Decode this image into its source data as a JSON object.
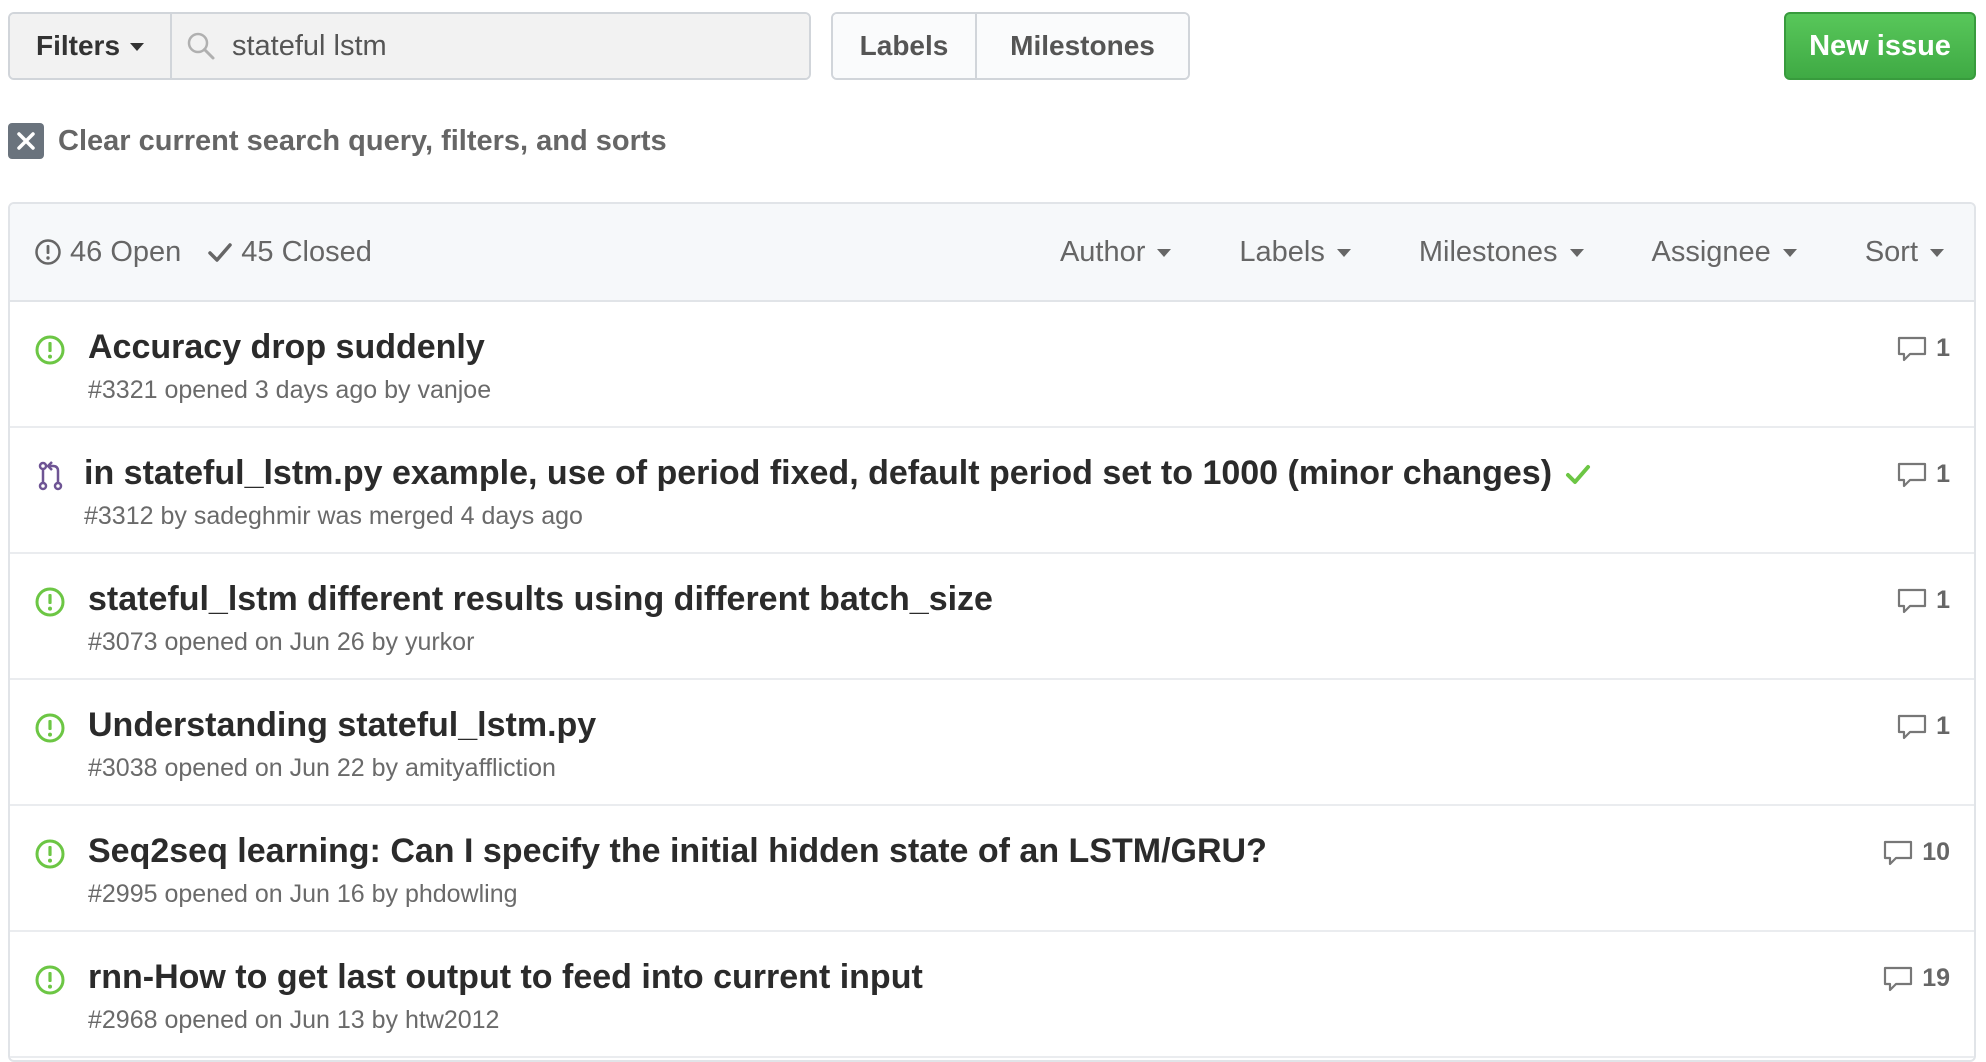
{
  "toolbar": {
    "filters_label": "Filters",
    "search_value": "stateful lstm",
    "labels_label": "Labels",
    "milestones_label": "Milestones",
    "new_issue_label": "New issue"
  },
  "clear_query": {
    "label": "Clear current search query, filters, and sorts"
  },
  "issues_header": {
    "open_label": "46 Open",
    "closed_label": "45 Closed",
    "menus": [
      "Author",
      "Labels",
      "Milestones",
      "Assignee",
      "Sort"
    ]
  },
  "issues": [
    {
      "type": "issue",
      "icon": "issue-opened-icon",
      "title": "Accuracy drop suddenly",
      "meta": "#3321 opened 3 days ago by vanjoe",
      "comments": "1"
    },
    {
      "type": "pr",
      "icon": "git-merge-icon",
      "title": "in stateful_lstm.py example, use of period fixed, default period set to 1000 (minor changes)",
      "meta": "#3312 by sadeghmir was merged 4 days ago",
      "comments": "1",
      "status": "check-icon"
    },
    {
      "type": "issue",
      "icon": "issue-opened-icon",
      "title": "stateful_lstm different results using different batch_size",
      "meta": "#3073 opened on Jun 26 by yurkor",
      "comments": "1"
    },
    {
      "type": "issue",
      "icon": "issue-opened-icon",
      "title": "Understanding stateful_lstm.py",
      "meta": "#3038 opened on Jun 22 by amityaffliction",
      "comments": "1"
    },
    {
      "type": "issue",
      "icon": "issue-opened-icon",
      "title": "Seq2seq learning: Can I specify the initial hidden state of an LSTM/GRU?",
      "meta": "#2995 opened on Jun 16 by phdowling",
      "comments": "10"
    },
    {
      "type": "issue",
      "icon": "issue-opened-icon",
      "title": "rnn-How to get last output to feed into current input",
      "meta": "#2968 opened on Jun 13 by htw2012",
      "comments": "19"
    }
  ],
  "colors": {
    "open_green": "#6cc644",
    "merged_purple": "#6e5494",
    "button_green": "#3faa44",
    "text_dark": "#2b2b2b",
    "text_muted": "#6a6a6a"
  }
}
